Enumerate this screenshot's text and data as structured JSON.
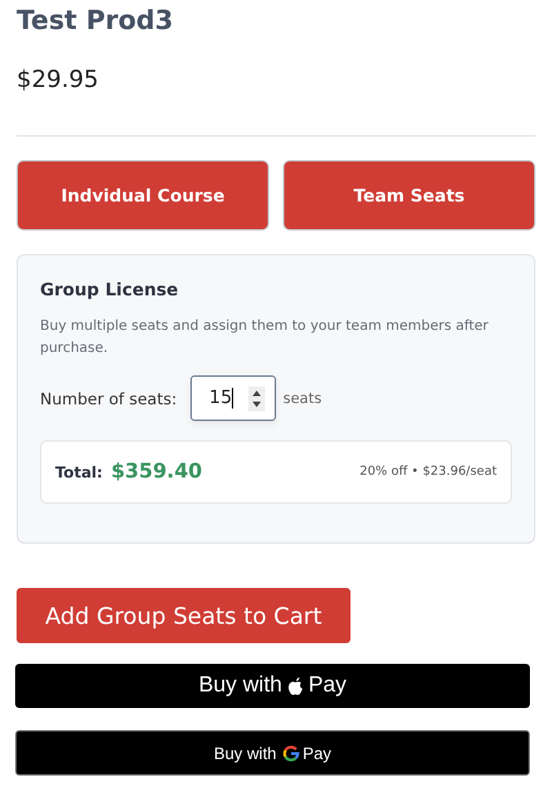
{
  "product": {
    "title": "Test Prod3",
    "price": "$29.95"
  },
  "options": [
    {
      "label": "Indvidual Course"
    },
    {
      "label": "Team Seats"
    }
  ],
  "group_license": {
    "title": "Group License",
    "description": "Buy multiple seats and assign them to your team members after purchase.",
    "seats_label": "Number of seats:",
    "seats_value": "15",
    "seats_unit": "seats",
    "total_label": "Total:",
    "total": "$359.40",
    "discount_note": "20% off • $23.96/seat"
  },
  "add_button": "Add Group Seats to Cart",
  "payment_buttons": [
    {
      "kind": "apple",
      "label": "Buy with",
      "brand": "Pay"
    },
    {
      "kind": "google",
      "label": "Buy with",
      "brand": "Pay"
    }
  ]
}
